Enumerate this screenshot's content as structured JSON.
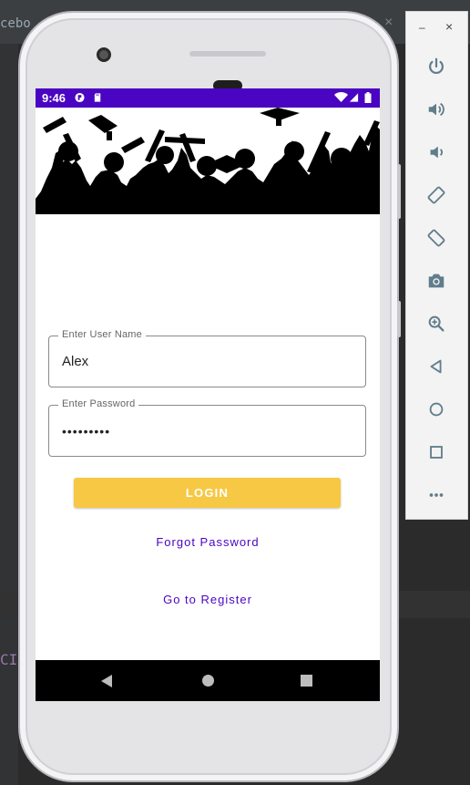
{
  "ide": {
    "tab_fragment": "cebo",
    "code_fragment": "CIL"
  },
  "status_bar": {
    "time": "9:46",
    "color": "#4a05c2"
  },
  "form": {
    "username_label": "Enter User Name",
    "username_value": "Alex",
    "password_label": "Enter Password",
    "password_value": "•••••••••"
  },
  "buttons": {
    "login": "LOGIN",
    "forgot_password": "Forgot Password",
    "register": "Go to Register"
  },
  "colors": {
    "accent": "#4a05c2",
    "button": "#f6c844"
  },
  "emulator_panel": {
    "minimize": "–",
    "close": "×",
    "tools": [
      "power-icon",
      "volume-up-icon",
      "volume-down-icon",
      "rotate-left-icon",
      "rotate-right-icon",
      "camera-icon",
      "zoom-icon",
      "back-icon",
      "home-icon",
      "overview-icon",
      "more-icon"
    ]
  }
}
